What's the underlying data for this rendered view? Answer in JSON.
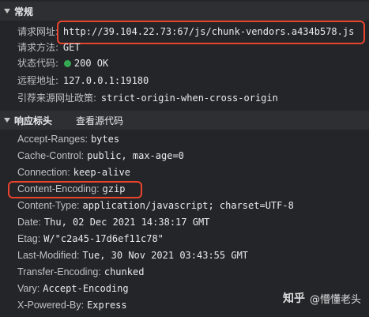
{
  "general": {
    "title": "常规",
    "request_url": {
      "label": "请求网址:",
      "value": "http://39.104.22.73:67/js/chunk-vendors.a434b578.js"
    },
    "request_method": {
      "label": "请求方法:",
      "value": "GET"
    },
    "status_code": {
      "label": "状态代码:",
      "value": "200 OK",
      "status_color": "#34a853"
    },
    "remote_address": {
      "label": "远程地址:",
      "value": "127.0.0.1:19180"
    },
    "referrer_policy": {
      "label": "引荐来源网址政策:",
      "value": "strict-origin-when-cross-origin"
    }
  },
  "response_headers": {
    "title": "响应标头",
    "view_source": "查看源代码",
    "items": [
      {
        "label": "Accept-Ranges:",
        "value": "bytes"
      },
      {
        "label": "Cache-Control:",
        "value": "public, max-age=0"
      },
      {
        "label": "Connection:",
        "value": "keep-alive"
      },
      {
        "label": "Content-Encoding:",
        "value": "gzip"
      },
      {
        "label": "Content-Type:",
        "value": "application/javascript; charset=UTF-8"
      },
      {
        "label": "Date:",
        "value": "Thu, 02 Dec 2021 14:38:17 GMT"
      },
      {
        "label": "Etag:",
        "value": "W/\"c2a45-17d6ef11c78\""
      },
      {
        "label": "Last-Modified:",
        "value": "Tue, 30 Nov 2021 03:43:55 GMT"
      },
      {
        "label": "Transfer-Encoding:",
        "value": "chunked"
      },
      {
        "label": "Vary:",
        "value": "Accept-Encoding"
      },
      {
        "label": "X-Powered-By:",
        "value": "Express"
      }
    ]
  },
  "watermark": {
    "logo": "知乎",
    "text": "@懵懂老头"
  },
  "colors": {
    "highlight": "#e8442e",
    "background": "#242528"
  }
}
